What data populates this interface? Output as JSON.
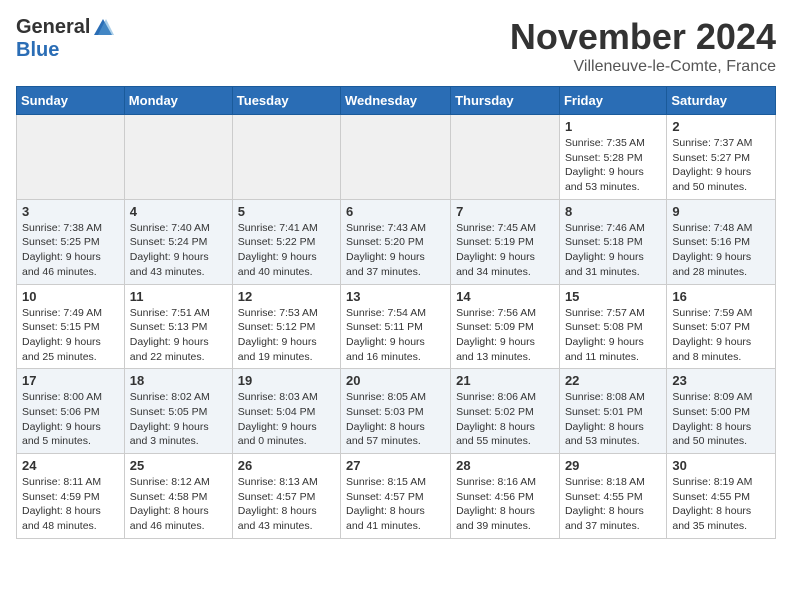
{
  "header": {
    "logo_general": "General",
    "logo_blue": "Blue",
    "month_title": "November 2024",
    "subtitle": "Villeneuve-le-Comte, France"
  },
  "days_of_week": [
    "Sunday",
    "Monday",
    "Tuesday",
    "Wednesday",
    "Thursday",
    "Friday",
    "Saturday"
  ],
  "weeks": [
    [
      {
        "day": "",
        "info": ""
      },
      {
        "day": "",
        "info": ""
      },
      {
        "day": "",
        "info": ""
      },
      {
        "day": "",
        "info": ""
      },
      {
        "day": "",
        "info": ""
      },
      {
        "day": "1",
        "info": "Sunrise: 7:35 AM\nSunset: 5:28 PM\nDaylight: 9 hours and 53 minutes."
      },
      {
        "day": "2",
        "info": "Sunrise: 7:37 AM\nSunset: 5:27 PM\nDaylight: 9 hours and 50 minutes."
      }
    ],
    [
      {
        "day": "3",
        "info": "Sunrise: 7:38 AM\nSunset: 5:25 PM\nDaylight: 9 hours and 46 minutes."
      },
      {
        "day": "4",
        "info": "Sunrise: 7:40 AM\nSunset: 5:24 PM\nDaylight: 9 hours and 43 minutes."
      },
      {
        "day": "5",
        "info": "Sunrise: 7:41 AM\nSunset: 5:22 PM\nDaylight: 9 hours and 40 minutes."
      },
      {
        "day": "6",
        "info": "Sunrise: 7:43 AM\nSunset: 5:20 PM\nDaylight: 9 hours and 37 minutes."
      },
      {
        "day": "7",
        "info": "Sunrise: 7:45 AM\nSunset: 5:19 PM\nDaylight: 9 hours and 34 minutes."
      },
      {
        "day": "8",
        "info": "Sunrise: 7:46 AM\nSunset: 5:18 PM\nDaylight: 9 hours and 31 minutes."
      },
      {
        "day": "9",
        "info": "Sunrise: 7:48 AM\nSunset: 5:16 PM\nDaylight: 9 hours and 28 minutes."
      }
    ],
    [
      {
        "day": "10",
        "info": "Sunrise: 7:49 AM\nSunset: 5:15 PM\nDaylight: 9 hours and 25 minutes."
      },
      {
        "day": "11",
        "info": "Sunrise: 7:51 AM\nSunset: 5:13 PM\nDaylight: 9 hours and 22 minutes."
      },
      {
        "day": "12",
        "info": "Sunrise: 7:53 AM\nSunset: 5:12 PM\nDaylight: 9 hours and 19 minutes."
      },
      {
        "day": "13",
        "info": "Sunrise: 7:54 AM\nSunset: 5:11 PM\nDaylight: 9 hours and 16 minutes."
      },
      {
        "day": "14",
        "info": "Sunrise: 7:56 AM\nSunset: 5:09 PM\nDaylight: 9 hours and 13 minutes."
      },
      {
        "day": "15",
        "info": "Sunrise: 7:57 AM\nSunset: 5:08 PM\nDaylight: 9 hours and 11 minutes."
      },
      {
        "day": "16",
        "info": "Sunrise: 7:59 AM\nSunset: 5:07 PM\nDaylight: 9 hours and 8 minutes."
      }
    ],
    [
      {
        "day": "17",
        "info": "Sunrise: 8:00 AM\nSunset: 5:06 PM\nDaylight: 9 hours and 5 minutes."
      },
      {
        "day": "18",
        "info": "Sunrise: 8:02 AM\nSunset: 5:05 PM\nDaylight: 9 hours and 3 minutes."
      },
      {
        "day": "19",
        "info": "Sunrise: 8:03 AM\nSunset: 5:04 PM\nDaylight: 9 hours and 0 minutes."
      },
      {
        "day": "20",
        "info": "Sunrise: 8:05 AM\nSunset: 5:03 PM\nDaylight: 8 hours and 57 minutes."
      },
      {
        "day": "21",
        "info": "Sunrise: 8:06 AM\nSunset: 5:02 PM\nDaylight: 8 hours and 55 minutes."
      },
      {
        "day": "22",
        "info": "Sunrise: 8:08 AM\nSunset: 5:01 PM\nDaylight: 8 hours and 53 minutes."
      },
      {
        "day": "23",
        "info": "Sunrise: 8:09 AM\nSunset: 5:00 PM\nDaylight: 8 hours and 50 minutes."
      }
    ],
    [
      {
        "day": "24",
        "info": "Sunrise: 8:11 AM\nSunset: 4:59 PM\nDaylight: 8 hours and 48 minutes."
      },
      {
        "day": "25",
        "info": "Sunrise: 8:12 AM\nSunset: 4:58 PM\nDaylight: 8 hours and 46 minutes."
      },
      {
        "day": "26",
        "info": "Sunrise: 8:13 AM\nSunset: 4:57 PM\nDaylight: 8 hours and 43 minutes."
      },
      {
        "day": "27",
        "info": "Sunrise: 8:15 AM\nSunset: 4:57 PM\nDaylight: 8 hours and 41 minutes."
      },
      {
        "day": "28",
        "info": "Sunrise: 8:16 AM\nSunset: 4:56 PM\nDaylight: 8 hours and 39 minutes."
      },
      {
        "day": "29",
        "info": "Sunrise: 8:18 AM\nSunset: 4:55 PM\nDaylight: 8 hours and 37 minutes."
      },
      {
        "day": "30",
        "info": "Sunrise: 8:19 AM\nSunset: 4:55 PM\nDaylight: 8 hours and 35 minutes."
      }
    ]
  ]
}
